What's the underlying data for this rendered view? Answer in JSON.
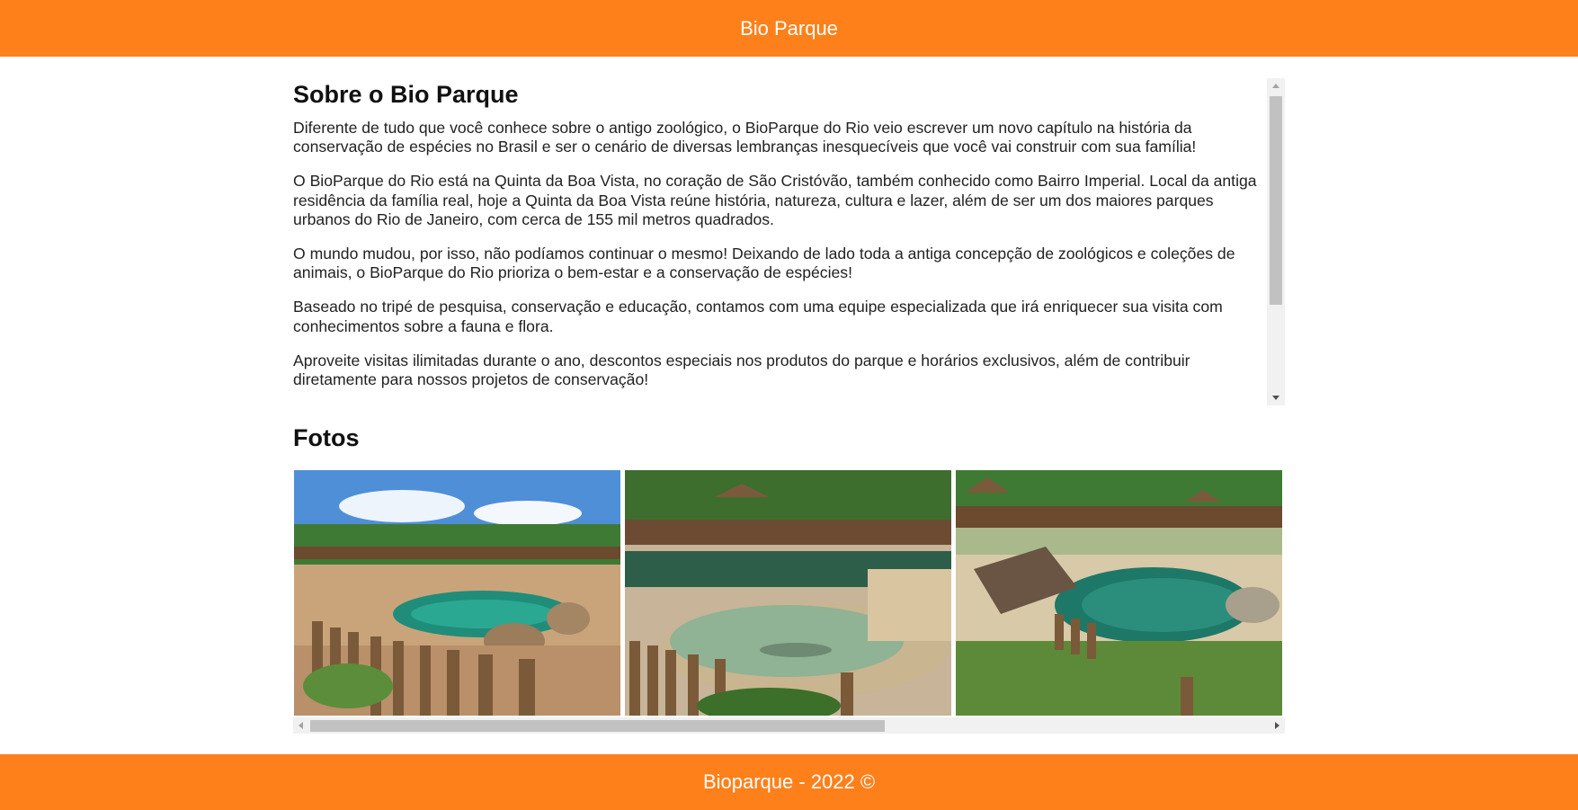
{
  "header": {
    "title": "Bio Parque"
  },
  "about": {
    "heading": "Sobre o Bio Parque",
    "paragraphs": [
      "Diferente de tudo que você conhece sobre o antigo zoológico, o BioParque do Rio veio escrever um novo capítulo na história da conservação de espécies no Brasil e ser o cenário de diversas lembranças inesquecíveis que você vai construir com sua família!",
      "O BioParque do Rio está na Quinta da Boa Vista, no coração de São Cristóvão, também conhecido como Bairro Imperial. Local da antiga residência da família real, hoje a Quinta da Boa Vista reúne história, natureza, cultura e lazer, além de ser um dos maiores parques urbanos do Rio de Janeiro, com cerca de 155 mil metros quadrados.",
      "O mundo mudou, por isso, não podíamos continuar o mesmo! Deixando de lado toda a antiga concepção de zoológicos e coleções de animais, o BioParque do Rio prioriza o bem-estar e a conservação de espécies!",
      "Baseado no tripé de pesquisa, conservação e educação, contamos com uma equipe especializada que irá enriquecer sua visita com conhecimentos sobre a fauna e flora.",
      "Aproveite visitas ilimitadas durante o ano, descontos especiais nos produtos do parque e horários exclusivos, além de contribuir diretamente para nossos projetos de conservação!"
    ]
  },
  "photos": {
    "heading": "Fotos"
  },
  "footer": {
    "text": "Bioparque - 2022 ©"
  },
  "colors": {
    "brand": "#fe801a"
  }
}
